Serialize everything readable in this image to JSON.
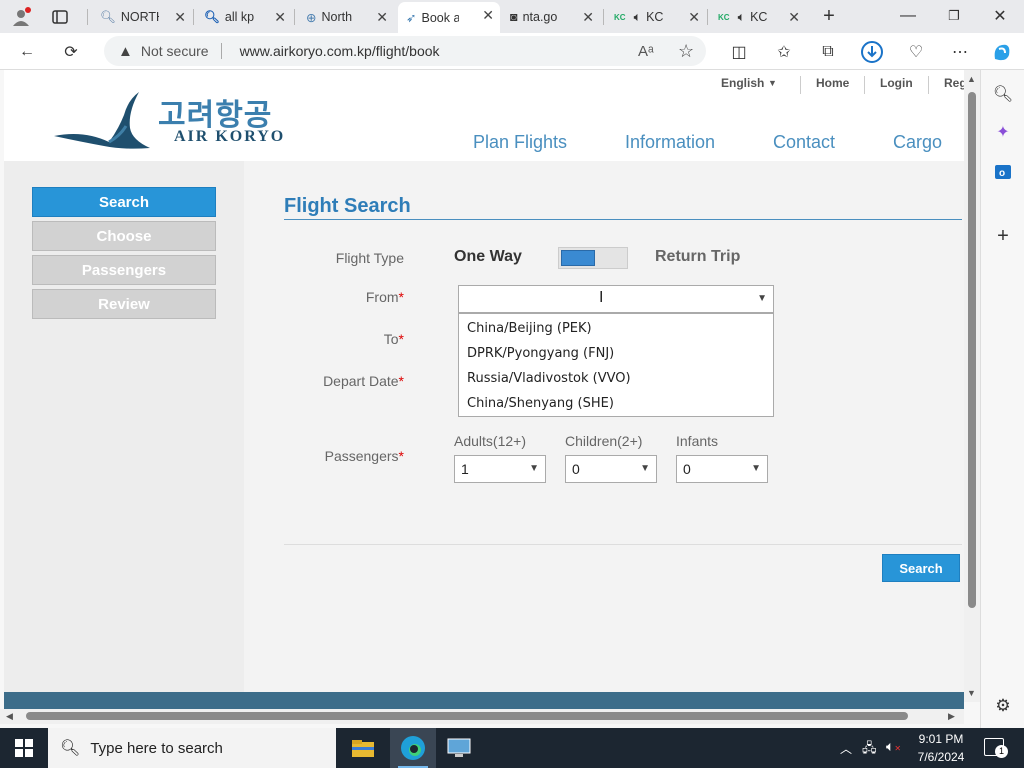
{
  "browser": {
    "tabs": [
      {
        "label": "NORTH",
        "icon": "search-icon"
      },
      {
        "label": "all kp",
        "icon": "search-icon"
      },
      {
        "label": "North",
        "icon": "globe-icon"
      },
      {
        "label": "Book a",
        "icon": "air-koryo-icon"
      },
      {
        "label": "nta.go",
        "icon": "site-icon"
      },
      {
        "label": "KC",
        "icon": "kcna-icon"
      },
      {
        "label": "KC",
        "icon": "kcna-icon"
      }
    ],
    "security_label": "Not secure",
    "url": "www.airkoryo.com.kp/flight/book"
  },
  "site": {
    "logo_korean": "고려항공",
    "logo_english": "AIR KORYO",
    "top_links": {
      "language": "English",
      "home": "Home",
      "login": "Login",
      "register": "Reg"
    },
    "nav": [
      "Plan Flights",
      "Information",
      "Contact",
      "Cargo"
    ]
  },
  "steps": [
    "Search",
    "Choose",
    "Passengers",
    "Review"
  ],
  "form": {
    "heading": "Flight Search",
    "flight_type_label": "Flight Type",
    "one_way": "One Way",
    "return_trip": "Return Trip",
    "from_label": "From",
    "to_label": "To",
    "depart_label": "Depart Date",
    "passengers_label": "Passengers",
    "required_mark": "*",
    "from_value": "",
    "dropdown_options": [
      "China/Beijing (PEK)",
      "DPRK/Pyongyang (FNJ)",
      "Russia/Vladivostok (VVO)",
      "China/Shenyang (SHE)"
    ],
    "adults_label": "Adults(12+)",
    "children_label": "Children(2+)",
    "infants_label": "Infants",
    "adults_value": "1",
    "children_value": "0",
    "infants_value": "0",
    "search_button": "Search"
  },
  "taskbar": {
    "search_placeholder": "Type here to search",
    "time": "9:01 PM",
    "date": "7/6/2024",
    "notification_count": "1"
  },
  "colors": {
    "accent": "#2895d8",
    "nav": "#4a8fbf",
    "heading": "#2e7db8"
  }
}
